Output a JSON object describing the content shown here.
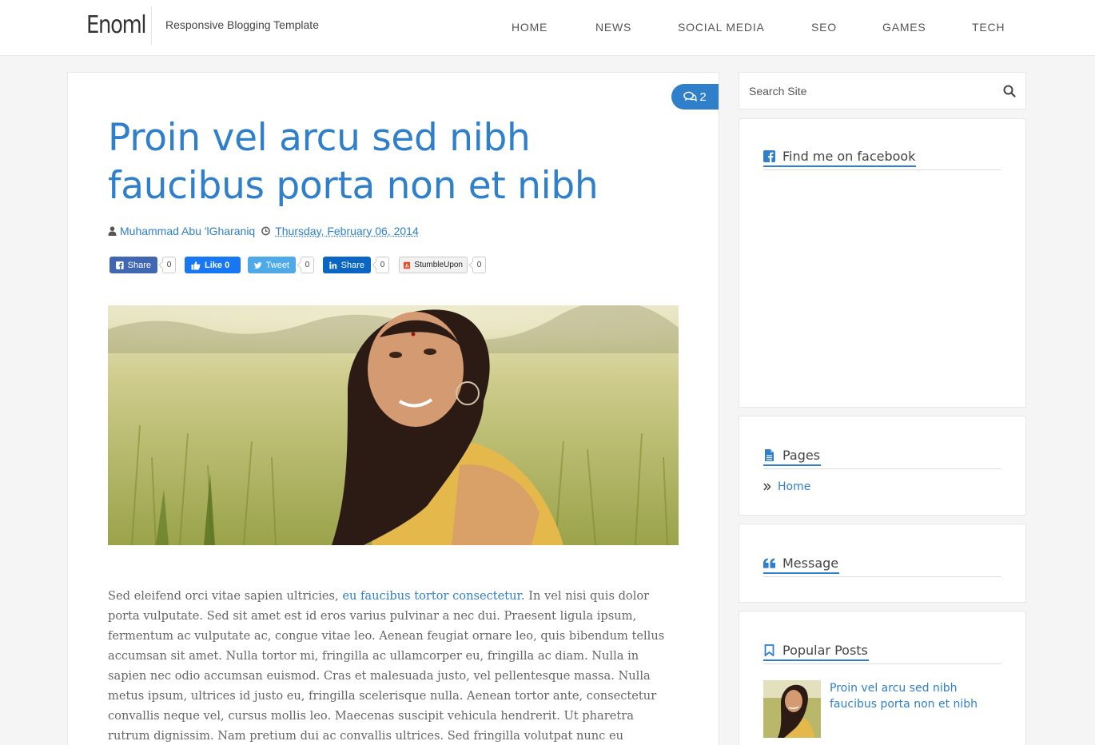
{
  "site": {
    "logo": "Enoml",
    "tagline": "Responsive Blogging Template"
  },
  "nav": {
    "items": [
      "HOME",
      "NEWS",
      "SOCIAL MEDIA",
      "SEO",
      "GAMES",
      "TECH"
    ]
  },
  "post": {
    "comment_count": "2",
    "title": "Proin vel arcu sed nibh faucibus porta non et nibh",
    "author": "Muhammad Abu 'lGharaniq",
    "date": "Thursday, February 06, 2014",
    "share": {
      "facebook_share": "Share",
      "facebook_share_count": "0",
      "facebook_like": "Like 0",
      "tweet": "Tweet",
      "tweet_count": "0",
      "linkedin_share": "Share",
      "linkedin_count": "0",
      "stumbleupon": "StumbleUpon",
      "stumbleupon_count": "0"
    },
    "body_before_link": "Sed eleifend orci vitae sapien ultricies, ",
    "body_link": "eu faucibus tortor consectetur",
    "body_after_link": ". In vel nisi quis dolor porta vulputate. Sed sit amet est id eros varius pulvinar a nec dui. Praesent ligula ipsum, fermentum ac vulputate ac, congue vitae leo. Aenean feugiat ornare leo, quis bibendum tellus accumsan sit amet. Nulla tortor mi, fringilla ac ullamcorper eu, fringilla ac diam. Nulla in sapien nec odio accumsan euismod. Cras et malesuada justo, vel pellentesque massa. Nulla metus ipsum, ultrices id justo eu, fringilla scelerisque nulla. Aenean tortor ante, consectetur convallis neque vel, cursus mollis leo. Maecenas suscipit vehicula hendrerit. Ut pharetra rutrum dignissim. Nam pretium dui ac convallis ultrices. Sed fringilla volutpat nunc eu tristique."
  },
  "sidebar": {
    "search_placeholder": "Search Site",
    "facebook_title": "Find me on facebook",
    "pages_title": "Pages",
    "pages_items": [
      "Home"
    ],
    "message_title": "Message",
    "popular_title": "Popular Posts",
    "popular_items": [
      "Proin vel arcu sed nibh faucibus porta non et nibh"
    ]
  },
  "colors": {
    "accent": "#2f7fca",
    "facebook": "#4267b2",
    "twitter": "#1da1f2",
    "linkedin": "#0077b5",
    "stumbleupon": "#eb4924"
  },
  "icons": {
    "comment": "comments-icon",
    "author": "user-icon",
    "date": "clock-icon",
    "search": "search-icon",
    "facebook_widget": "facebook-square-icon",
    "pages_widget": "file-text-icon",
    "message_widget": "quote-left-icon",
    "popular_widget": "bookmark-icon",
    "page_bullet": "angle-double-right-icon"
  }
}
